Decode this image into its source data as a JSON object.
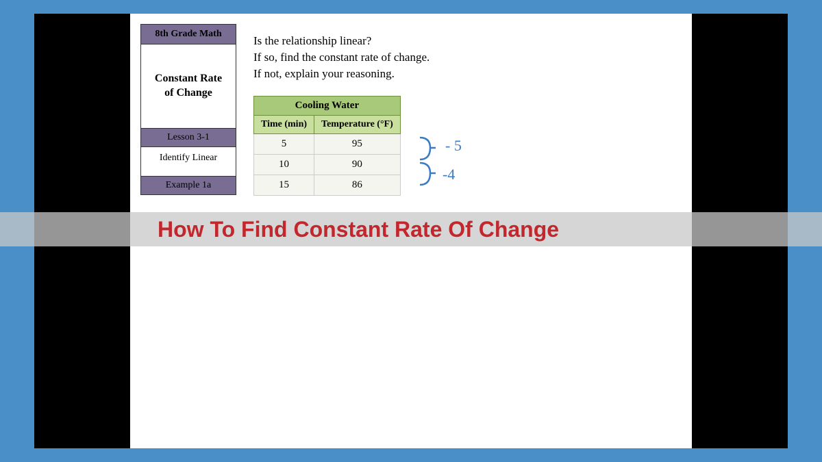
{
  "sidebar": {
    "grade": "8th Grade Math",
    "topic_line1": "Constant Rate",
    "topic_line2": "of Change",
    "lesson": "Lesson 3-1",
    "identify": "Identify Linear",
    "example": "Example 1a"
  },
  "question": {
    "line1": "Is the relationship linear?",
    "line2": "If so, find the constant rate of change.",
    "line3": "If not, explain your reasoning."
  },
  "table": {
    "title": "Cooling Water",
    "col1_header": "Time (min)",
    "col2_header": "Temperature (°F)",
    "rows": [
      {
        "time": "5",
        "temp": "95"
      },
      {
        "time": "10",
        "temp": "90"
      },
      {
        "time": "15",
        "temp": "86"
      }
    ]
  },
  "annotations": {
    "diff1": "- 5",
    "diff2": "-4"
  },
  "overlay": {
    "title": "How To Find Constant Rate Of Change"
  }
}
